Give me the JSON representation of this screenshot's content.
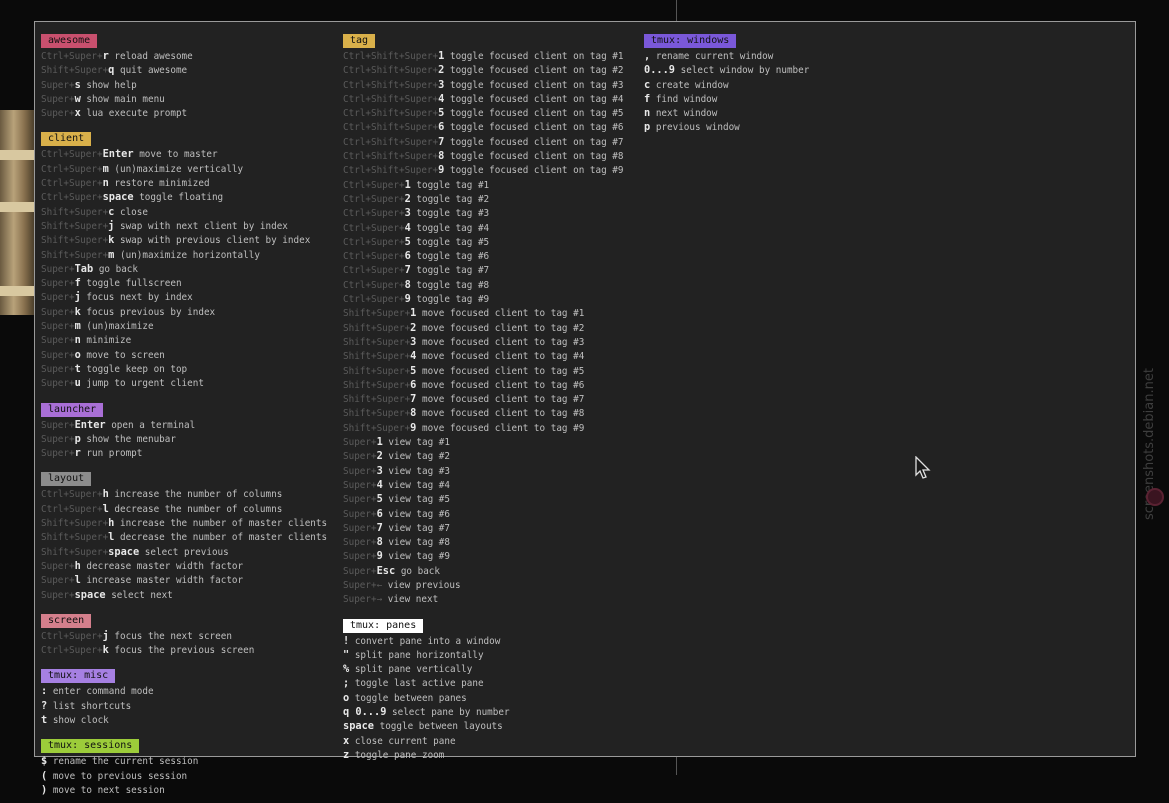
{
  "colors": {
    "awesome": "#c8506e",
    "client": "#d9b04a",
    "launcher": "#a96fd6",
    "layout": "#8c8c8c",
    "screen": "#d47f8c",
    "tmux_misc": "#a680e2",
    "tmux_sessions": "#9ccc3a",
    "tag": "#d9b04a",
    "tmux_panes": "#ffffff",
    "tmux_windows": "#7a58d9"
  },
  "watermark": "screenshots.debian.net",
  "columns": [
    [
      {
        "id": "awesome",
        "title": "awesome",
        "rows": [
          {
            "mod": "Ctrl+Super+",
            "key": "r",
            "desc": "reload awesome"
          },
          {
            "mod": "Shift+Super+",
            "key": "q",
            "desc": "quit awesome"
          },
          {
            "mod": "Super+",
            "key": "s",
            "desc": "show help"
          },
          {
            "mod": "Super+",
            "key": "w",
            "desc": "show main menu"
          },
          {
            "mod": "Super+",
            "key": "x",
            "desc": "lua execute prompt"
          }
        ]
      },
      {
        "id": "client",
        "title": "client",
        "rows": [
          {
            "mod": "Ctrl+Super+",
            "key": "Enter",
            "desc": "move to master"
          },
          {
            "mod": "Ctrl+Super+",
            "key": "m",
            "desc": "(un)maximize vertically"
          },
          {
            "mod": "Ctrl+Super+",
            "key": "n",
            "desc": "restore minimized"
          },
          {
            "mod": "Ctrl+Super+",
            "key": "space",
            "desc": "toggle floating"
          },
          {
            "mod": "Shift+Super+",
            "key": "c",
            "desc": "close"
          },
          {
            "mod": "Shift+Super+",
            "key": "j",
            "desc": "swap with next client by index"
          },
          {
            "mod": "Shift+Super+",
            "key": "k",
            "desc": "swap with previous client by index"
          },
          {
            "mod": "Shift+Super+",
            "key": "m",
            "desc": "(un)maximize horizontally"
          },
          {
            "mod": "Super+",
            "key": "Tab",
            "desc": "go back"
          },
          {
            "mod": "Super+",
            "key": "f",
            "desc": "toggle fullscreen"
          },
          {
            "mod": "Super+",
            "key": "j",
            "desc": "focus next by index"
          },
          {
            "mod": "Super+",
            "key": "k",
            "desc": "focus previous by index"
          },
          {
            "mod": "Super+",
            "key": "m",
            "desc": "(un)maximize"
          },
          {
            "mod": "Super+",
            "key": "n",
            "desc": "minimize"
          },
          {
            "mod": "Super+",
            "key": "o",
            "desc": "move to screen"
          },
          {
            "mod": "Super+",
            "key": "t",
            "desc": "toggle keep on top"
          },
          {
            "mod": "Super+",
            "key": "u",
            "desc": "jump to urgent client"
          }
        ]
      },
      {
        "id": "launcher",
        "title": "launcher",
        "rows": [
          {
            "mod": "Super+",
            "key": "Enter",
            "desc": "open a terminal"
          },
          {
            "mod": "Super+",
            "key": "p",
            "desc": "show the menubar"
          },
          {
            "mod": "Super+",
            "key": "r",
            "desc": "run prompt"
          }
        ]
      },
      {
        "id": "layout",
        "title": "layout",
        "rows": [
          {
            "mod": "Ctrl+Super+",
            "key": "h",
            "desc": "increase the number of columns"
          },
          {
            "mod": "Ctrl+Super+",
            "key": "l",
            "desc": "decrease the number of columns"
          },
          {
            "mod": "Shift+Super+",
            "key": "h",
            "desc": "increase the number of master clients"
          },
          {
            "mod": "Shift+Super+",
            "key": "l",
            "desc": "decrease the number of master clients"
          },
          {
            "mod": "Shift+Super+",
            "key": "space",
            "desc": "select previous"
          },
          {
            "mod": "Super+",
            "key": "h",
            "desc": "decrease master width factor"
          },
          {
            "mod": "Super+",
            "key": "l",
            "desc": "increase master width factor"
          },
          {
            "mod": "Super+",
            "key": "space",
            "desc": "select next"
          }
        ]
      },
      {
        "id": "screen",
        "title": "screen",
        "rows": [
          {
            "mod": "Ctrl+Super+",
            "key": "j",
            "desc": "focus the next screen"
          },
          {
            "mod": "Ctrl+Super+",
            "key": "k",
            "desc": "focus the previous screen"
          }
        ]
      },
      {
        "id": "tmux_misc",
        "title": "tmux: misc",
        "rows": [
          {
            "mod": "",
            "key": ":",
            "desc": "enter command mode"
          },
          {
            "mod": "",
            "key": "?",
            "desc": "list shortcuts"
          },
          {
            "mod": "",
            "key": "t",
            "desc": "show clock"
          }
        ]
      },
      {
        "id": "tmux_sessions",
        "title": "tmux: sessions",
        "rows": [
          {
            "mod": "",
            "key": "$",
            "desc": "rename the current session"
          },
          {
            "mod": "",
            "key": "(",
            "desc": "move to previous session"
          },
          {
            "mod": "",
            "key": ")",
            "desc": "move to next session"
          }
        ]
      }
    ],
    [
      {
        "id": "tag",
        "title": "tag",
        "rows": [
          {
            "mod": "Ctrl+Shift+Super+",
            "key": "1",
            "desc": "toggle focused client on tag #1"
          },
          {
            "mod": "Ctrl+Shift+Super+",
            "key": "2",
            "desc": "toggle focused client on tag #2"
          },
          {
            "mod": "Ctrl+Shift+Super+",
            "key": "3",
            "desc": "toggle focused client on tag #3"
          },
          {
            "mod": "Ctrl+Shift+Super+",
            "key": "4",
            "desc": "toggle focused client on tag #4"
          },
          {
            "mod": "Ctrl+Shift+Super+",
            "key": "5",
            "desc": "toggle focused client on tag #5"
          },
          {
            "mod": "Ctrl+Shift+Super+",
            "key": "6",
            "desc": "toggle focused client on tag #6"
          },
          {
            "mod": "Ctrl+Shift+Super+",
            "key": "7",
            "desc": "toggle focused client on tag #7"
          },
          {
            "mod": "Ctrl+Shift+Super+",
            "key": "8",
            "desc": "toggle focused client on tag #8"
          },
          {
            "mod": "Ctrl+Shift+Super+",
            "key": "9",
            "desc": "toggle focused client on tag #9"
          },
          {
            "mod": "Ctrl+Super+",
            "key": "1",
            "desc": "toggle tag #1"
          },
          {
            "mod": "Ctrl+Super+",
            "key": "2",
            "desc": "toggle tag #2"
          },
          {
            "mod": "Ctrl+Super+",
            "key": "3",
            "desc": "toggle tag #3"
          },
          {
            "mod": "Ctrl+Super+",
            "key": "4",
            "desc": "toggle tag #4"
          },
          {
            "mod": "Ctrl+Super+",
            "key": "5",
            "desc": "toggle tag #5"
          },
          {
            "mod": "Ctrl+Super+",
            "key": "6",
            "desc": "toggle tag #6"
          },
          {
            "mod": "Ctrl+Super+",
            "key": "7",
            "desc": "toggle tag #7"
          },
          {
            "mod": "Ctrl+Super+",
            "key": "8",
            "desc": "toggle tag #8"
          },
          {
            "mod": "Ctrl+Super+",
            "key": "9",
            "desc": "toggle tag #9"
          },
          {
            "mod": "Shift+Super+",
            "key": "1",
            "desc": "move focused client to tag #1"
          },
          {
            "mod": "Shift+Super+",
            "key": "2",
            "desc": "move focused client to tag #2"
          },
          {
            "mod": "Shift+Super+",
            "key": "3",
            "desc": "move focused client to tag #3"
          },
          {
            "mod": "Shift+Super+",
            "key": "4",
            "desc": "move focused client to tag #4"
          },
          {
            "mod": "Shift+Super+",
            "key": "5",
            "desc": "move focused client to tag #5"
          },
          {
            "mod": "Shift+Super+",
            "key": "6",
            "desc": "move focused client to tag #6"
          },
          {
            "mod": "Shift+Super+",
            "key": "7",
            "desc": "move focused client to tag #7"
          },
          {
            "mod": "Shift+Super+",
            "key": "8",
            "desc": "move focused client to tag #8"
          },
          {
            "mod": "Shift+Super+",
            "key": "9",
            "desc": "move focused client to tag #9"
          },
          {
            "mod": "Super+",
            "key": "1",
            "desc": "view tag #1"
          },
          {
            "mod": "Super+",
            "key": "2",
            "desc": "view tag #2"
          },
          {
            "mod": "Super+",
            "key": "3",
            "desc": "view tag #3"
          },
          {
            "mod": "Super+",
            "key": "4",
            "desc": "view tag #4"
          },
          {
            "mod": "Super+",
            "key": "5",
            "desc": "view tag #5"
          },
          {
            "mod": "Super+",
            "key": "6",
            "desc": "view tag #6"
          },
          {
            "mod": "Super+",
            "key": "7",
            "desc": "view tag #7"
          },
          {
            "mod": "Super+",
            "key": "8",
            "desc": "view tag #8"
          },
          {
            "mod": "Super+",
            "key": "9",
            "desc": "view tag #9"
          },
          {
            "mod": "Super+",
            "key": "Esc",
            "desc": "go back"
          },
          {
            "mod": "Super+←",
            "key": "",
            "desc": "view previous"
          },
          {
            "mod": "Super+→",
            "key": "",
            "desc": "view next"
          }
        ]
      },
      {
        "id": "tmux_panes",
        "title": "tmux: panes",
        "rows": [
          {
            "mod": "",
            "key": "!",
            "desc": "convert pane into a window"
          },
          {
            "mod": "",
            "key": "\"",
            "desc": "split pane horizontally"
          },
          {
            "mod": "",
            "key": "%",
            "desc": "split pane vertically"
          },
          {
            "mod": "",
            "key": ";",
            "desc": "toggle last active pane"
          },
          {
            "mod": "",
            "key": "o",
            "desc": "toggle between panes"
          },
          {
            "mod": "",
            "key": "q 0...9",
            "desc": "select pane by number"
          },
          {
            "mod": "",
            "key": "space",
            "desc": "toggle between layouts"
          },
          {
            "mod": "",
            "key": "x",
            "desc": "close current pane"
          },
          {
            "mod": "",
            "key": "z",
            "desc": "toggle pane zoom"
          }
        ]
      }
    ],
    [
      {
        "id": "tmux_windows",
        "title": "tmux: windows",
        "rows": [
          {
            "mod": "",
            "key": ",",
            "desc": "rename current window"
          },
          {
            "mod": "",
            "key": "0...9",
            "desc": "select window by number"
          },
          {
            "mod": "",
            "key": "c",
            "desc": "create window"
          },
          {
            "mod": "",
            "key": "f",
            "desc": "find window"
          },
          {
            "mod": "",
            "key": "n",
            "desc": "next window"
          },
          {
            "mod": "",
            "key": "p",
            "desc": "previous window"
          }
        ]
      }
    ]
  ]
}
